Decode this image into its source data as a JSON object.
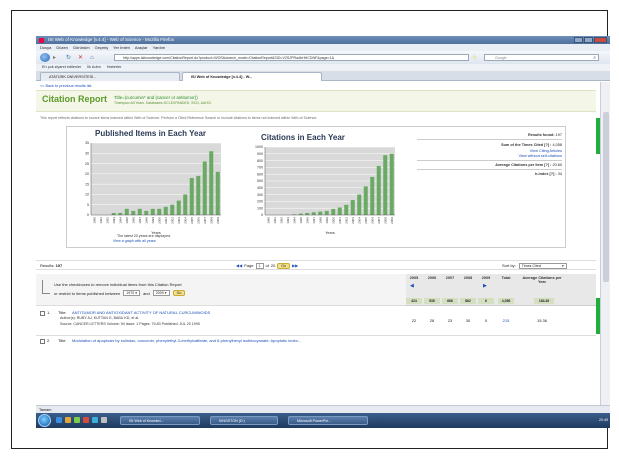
{
  "window": {
    "title": "ISI Web of Knowledge [v.4.4] - Web of Science - Mozilla Firefox"
  },
  "menu": [
    "Dosya",
    "Düzen",
    "Görünüm",
    "Geçmiş",
    "Yer İmleri",
    "Araçlar",
    "Yardım"
  ],
  "nav": {
    "address": "http://apps.isiknowledge.com/CitationReport.do?product=WOS&search_mode=CitationReport&SID=V2SJPRa4bHHCDNF&page=1&",
    "search_placeholder": "Google"
  },
  "bookmarks": [
    "En çok ziyaret edilenler",
    "İlk Adım",
    "Haberler"
  ],
  "tabs": [
    "ATATÜRK ÜNİVERSİTESİ...",
    "ISI Web of Knowledge [v.4.4] - W..."
  ],
  "page": {
    "back_link": "<< Back to previous results list",
    "title": "Citation Report",
    "query": "Title=(curcumin* and (cancer or antitumor))",
    "timespan": "Timespan=All Years. Databases=SCI-EXPANDED, SSCI, A&HCI.",
    "note": "This report reflects citations to source items indexed within Web of Science. Perform a Cited Reference Search to include citations to items not indexed within Web of Science."
  },
  "stats": {
    "results_found_label": "Results found:",
    "results_found": "197",
    "sum_label": "Sum of the Times Cited [?] :",
    "sum": "4,058",
    "view_citing": "View Citing Articles",
    "view_without": "View without self-citations",
    "avg_label": "Average Citations per Item [?] :",
    "avg": "20.60",
    "hindex_label": "h-index [?] :",
    "hindex": "34"
  },
  "charts_footer": {
    "note": "The latest 20 years are displayed.",
    "link": "View a graph with all years"
  },
  "chart_data": [
    {
      "type": "bar",
      "title": "Published Items in Each Year",
      "xlabel": "Years",
      "ylabel": "",
      "ylim": [
        0,
        35
      ],
      "yticks": [
        0,
        5,
        10,
        15,
        20,
        25,
        30,
        35
      ],
      "categories": [
        "1990",
        "1991",
        "1992",
        "1993",
        "1994",
        "1995",
        "1996",
        "1997",
        "1998",
        "1999",
        "2000",
        "2001",
        "2002",
        "2003",
        "2004",
        "2005",
        "2006",
        "2007",
        "2008",
        "2009"
      ],
      "values": [
        0,
        0,
        0,
        1,
        1,
        3,
        2,
        3,
        2,
        3,
        3,
        4,
        5,
        7,
        10,
        18,
        19,
        26,
        31,
        21
      ],
      "color": "#6aaa64"
    },
    {
      "type": "bar",
      "title": "Citations in Each Year",
      "xlabel": "Years",
      "ylabel": "",
      "ylim": [
        0,
        1000
      ],
      "yticks": [
        0,
        100,
        200,
        300,
        400,
        500,
        600,
        700,
        800,
        900,
        1000
      ],
      "categories": [
        "1990",
        "1991",
        "1992",
        "1993",
        "1994",
        "1995",
        "1996",
        "1997",
        "1998",
        "1999",
        "2000",
        "2001",
        "2002",
        "2003",
        "2004",
        "2005",
        "2006",
        "2007",
        "2008",
        "2009"
      ],
      "values": [
        0,
        0,
        0,
        0,
        10,
        20,
        30,
        40,
        50,
        60,
        90,
        110,
        150,
        220,
        300,
        420,
        560,
        720,
        880,
        900
      ],
      "color": "#6aaa64"
    }
  ],
  "results_bar": {
    "results_label": "Results:",
    "results": "197",
    "page_label": "Page",
    "page": "1",
    "of_label": "of",
    "total_pages": "20",
    "go": "Go",
    "sort_label": "Sort by:",
    "sort_value": "Times Cited"
  },
  "table": {
    "instruction": "Use the checkboxes to remove individual items from this Citation Report",
    "range_label": "or restrict to items published between",
    "range_from": "1970",
    "range_and": "and",
    "range_to": "2009",
    "years": [
      "2005",
      "2006",
      "2007",
      "2008",
      "2009"
    ],
    "total_label": "Total",
    "avg_label": "Average Citations per Year",
    "year_totals": [
      "424",
      "535",
      "666",
      "862",
      "6",
      "4,058",
      "184.45"
    ],
    "rows": [
      {
        "num": "1.",
        "title_label": "Title:",
        "title": "ANTITUMOR AND ANTIOXIDANT ACTIVITY OF NATURAL CURCUMINOIDS",
        "authors_label": "Author(s):",
        "authors": "RUBY AJ, KUTTAN G, BABU KD, et al.",
        "source": "Source: CANCER LETTERS  Volume: 94  Issue: 1  Pages: 79-83  Published: JUL 20 1995",
        "values": [
          "22",
          "28",
          "23",
          "30",
          "0",
          "215",
          "15.36"
        ]
      },
      {
        "num": "2.",
        "title_label": "Title:",
        "title": "Modulation of apoptosis by sulindac, curcumin, phenylethyl-3-methylcaffeate, and 6-phenylhexyl isothiocyanate: Apoptotic index..."
      }
    ]
  },
  "statusbar": "Tamam",
  "taskbar": {
    "tasks": [
      "ISI Web of Knowled...",
      "KINGSTON (D:)",
      "Microsoft PowerPoi..."
    ],
    "clock": "20:45"
  }
}
